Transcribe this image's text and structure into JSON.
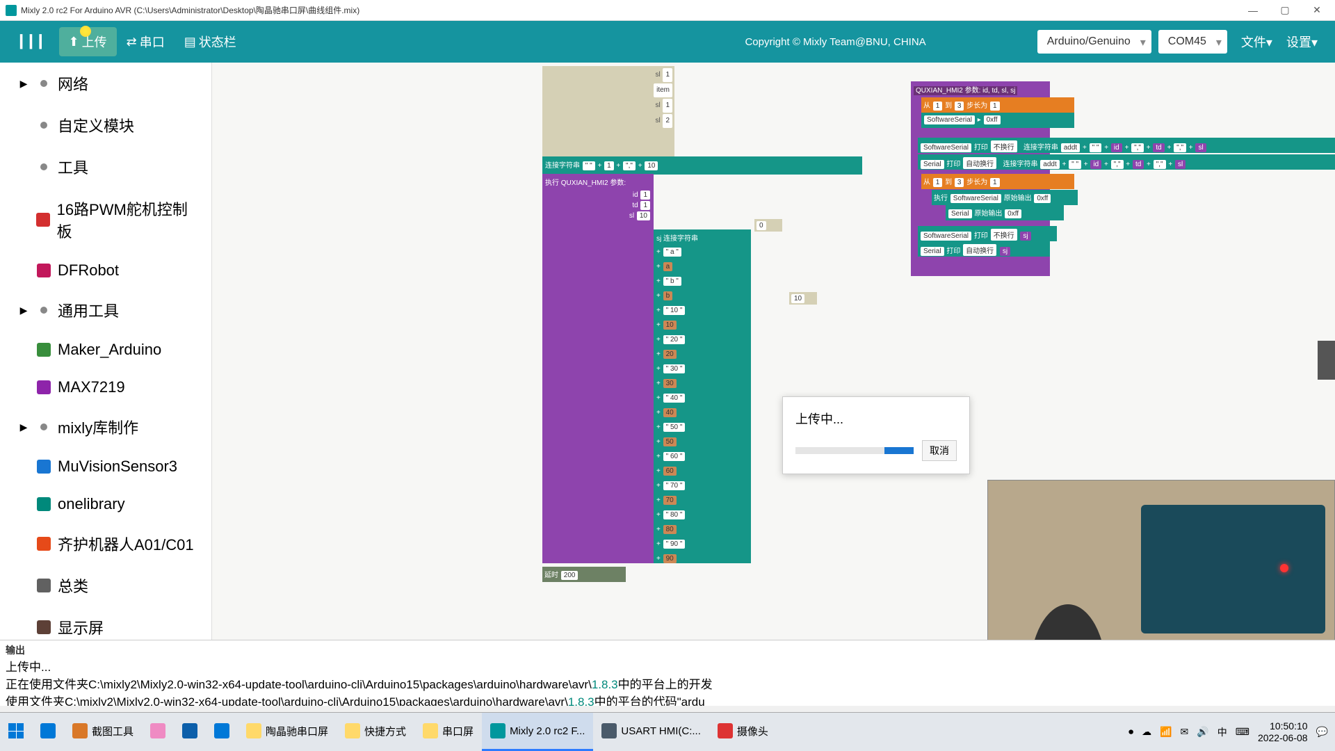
{
  "title": "Mixly 2.0 rc2 For Arduino AVR (C:\\Users\\Administrator\\Desktop\\陶晶驰串口屏\\曲线组件.mix)",
  "toolbar": {
    "upload": "上传",
    "serial": "串口",
    "status": "状态栏"
  },
  "copyright": "Copyright © Mixly Team@BNU, CHINA",
  "board": "Arduino/Genuino",
  "port": "COM45",
  "menu": {
    "file": "文件",
    "settings": "设置"
  },
  "categories": [
    {
      "label": "网络",
      "tri": "▶",
      "color": ""
    },
    {
      "label": "自定义模块",
      "tri": "",
      "color": ""
    },
    {
      "label": "工具",
      "tri": "",
      "color": ""
    },
    {
      "label": "16路PWM舵机控制板",
      "tri": "",
      "color": "#d32f2f"
    },
    {
      "label": "DFRobot",
      "tri": "",
      "color": "#c2185b"
    },
    {
      "label": "通用工具",
      "tri": "▶",
      "color": ""
    },
    {
      "label": "Maker_Arduino",
      "tri": "",
      "color": "#388e3c"
    },
    {
      "label": "MAX7219",
      "tri": "",
      "color": "#8e24aa"
    },
    {
      "label": "mixly库制作",
      "tri": "▶",
      "color": ""
    },
    {
      "label": "MuVisionSensor3",
      "tri": "",
      "color": "#1976d2"
    },
    {
      "label": "onelibrary",
      "tri": "",
      "color": "#00897b"
    },
    {
      "label": "齐护机器人A01/C01",
      "tri": "",
      "color": "#e64a19"
    },
    {
      "label": "总类",
      "tri": "",
      "color": "#616161"
    },
    {
      "label": "显示屏",
      "tri": "",
      "color": "#5d4037"
    }
  ],
  "blocks": {
    "quxian1": "执行 QUXIAN_HMI2 参数:",
    "quxian2": "QUXIAN_HMI2 参数: id, td, sl, sj",
    "softserial": "SoftwareSerial",
    "serial": "Serial",
    "print": "打印",
    "noline": "不换行",
    "autoline": "自动换行",
    "linkstr": "连接字符串",
    "item": "item",
    "vals": [
      "id",
      "td",
      "sl",
      "sj"
    ],
    "ints": [
      "1",
      "1",
      "2",
      "10",
      "0",
      "200"
    ],
    "steps": [
      "a",
      "b",
      "10",
      "20",
      "30",
      "40",
      "50",
      "60",
      "70",
      "80",
      "90"
    ],
    "joinvals": [
      "addt",
      "\" \"",
      "id",
      "\",\"",
      "td",
      "\",\"",
      "sl"
    ],
    "hex": "0xff",
    "range": {
      "from": "从",
      "to": "到",
      "step": "步长为",
      "v1": "1",
      "v2": "3",
      "v3": "1"
    }
  },
  "dialog": {
    "title": "上传中...",
    "cancel": "取消"
  },
  "console": {
    "header": "输出",
    "l1": "上传中...",
    "l2a": "正在使用文件夹C:\\mixly2\\Mixly2.0-win32-x64-update-tool\\arduino-cli\\Arduino15\\packages\\arduino\\hardware\\avr\\",
    "l2b": "1.8.3",
    "l2c": "中的平台上的开发",
    "l3a": "使用文件夹C:\\mixly2\\Mixly2.0-win32-x64-update-tool\\arduino-cli\\Arduino15\\packages\\arduino\\hardware\\avr\\",
    "l3b": "1.8.3",
    "l3c": "中的平台的代码\"ardu"
  },
  "taskbar": {
    "items": [
      {
        "label": "",
        "color": "#0078d7"
      },
      {
        "label": "截图工具",
        "color": "#d97828"
      },
      {
        "label": "",
        "color": "#ef8bc3"
      },
      {
        "label": "",
        "color": "#0c5faa"
      },
      {
        "label": "",
        "color": "#0078d7"
      },
      {
        "label": "陶晶驰串口屏",
        "color": "#ffd96a"
      },
      {
        "label": "快捷方式",
        "color": "#ffd96a"
      },
      {
        "label": "串口屏",
        "color": "#ffd96a"
      },
      {
        "label": "Mixly 2.0 rc2 F...",
        "color": "#00979d",
        "active": true
      },
      {
        "label": "USART HMI(C:...",
        "color": "#4a5a6a"
      },
      {
        "label": "摄像头",
        "color": "#d33"
      }
    ],
    "time": "10:50:10",
    "date": "2022-06-08"
  }
}
